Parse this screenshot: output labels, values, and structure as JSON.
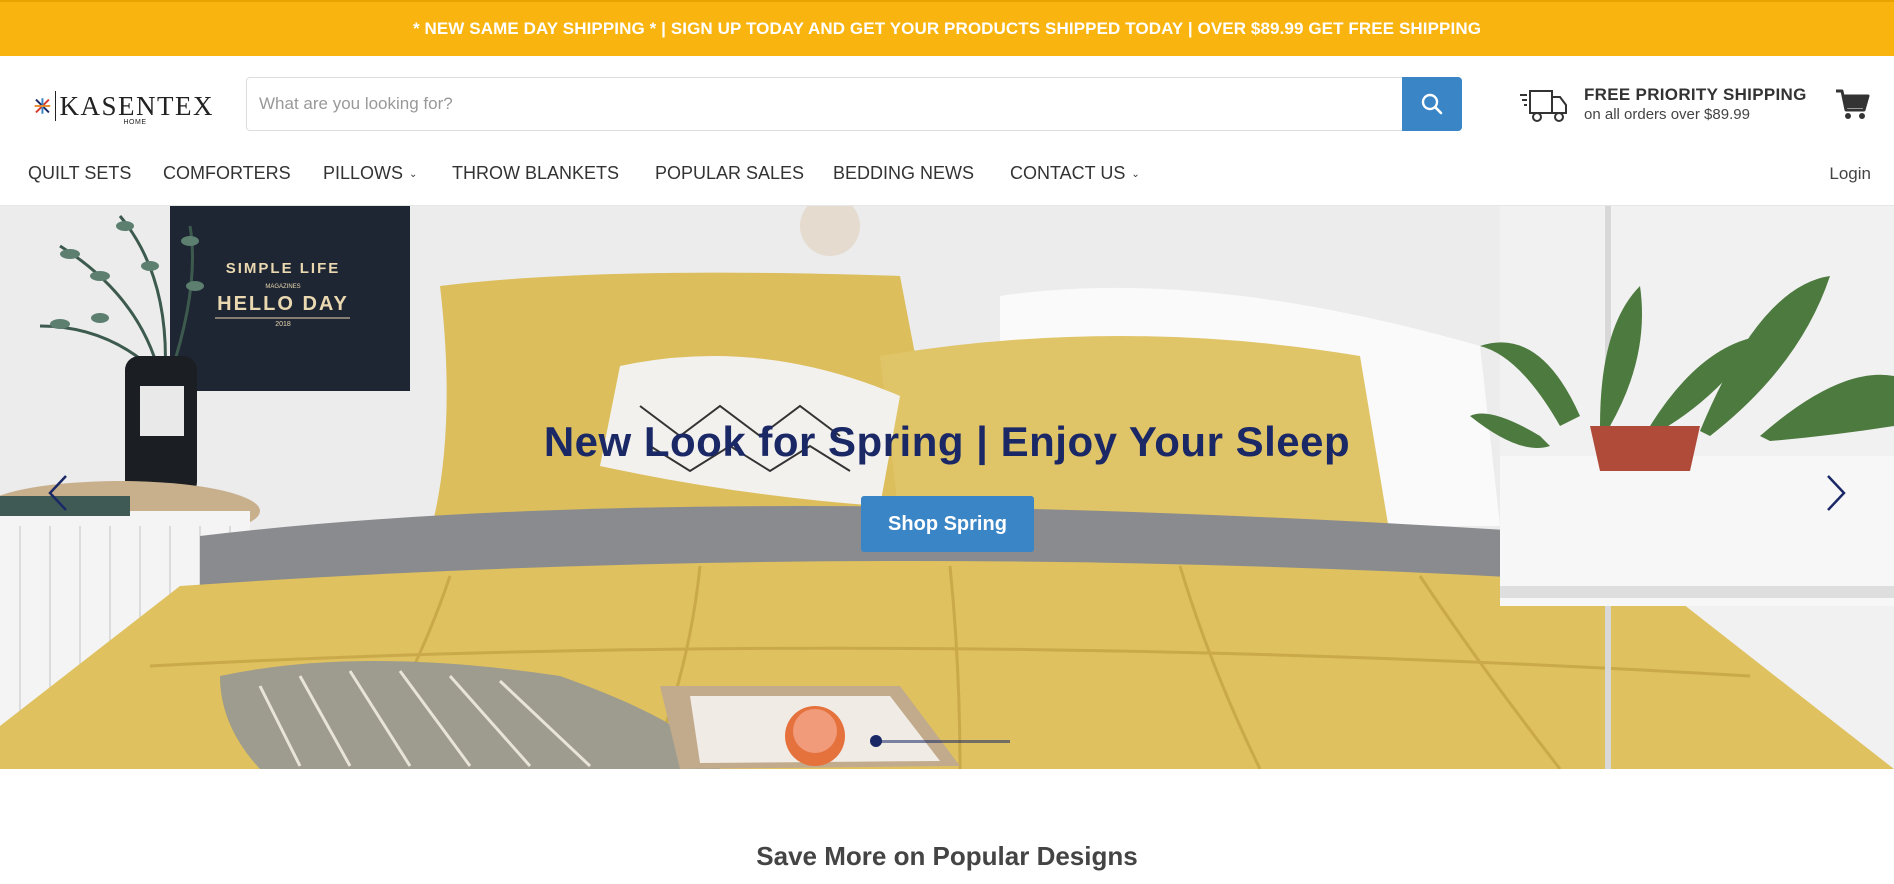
{
  "announcement": "* NEW SAME DAY SHIPPING * | SIGN UP TODAY AND GET YOUR PRODUCTS SHIPPED TODAY | OVER $89.99 GET FREE SHIPPING",
  "brand": {
    "name": "KASENTEX",
    "sub": "HOME"
  },
  "search": {
    "placeholder": "What are you looking for?",
    "value": ""
  },
  "shipping": {
    "title": "FREE PRIORITY SHIPPING",
    "subtitle": "on all orders over $89.99"
  },
  "nav": {
    "items": [
      {
        "label": "QUILT SETS",
        "dropdown": false
      },
      {
        "label": "COMFORTERS",
        "dropdown": false
      },
      {
        "label": "PILLOWS",
        "dropdown": true
      },
      {
        "label": "THROW BLANKETS",
        "dropdown": false
      },
      {
        "label": "POPULAR SALES",
        "dropdown": false
      },
      {
        "label": "BEDDING NEWS",
        "dropdown": false
      },
      {
        "label": "CONTACT US",
        "dropdown": true
      }
    ],
    "login": "Login"
  },
  "hero": {
    "title": "New Look for Spring | Enjoy Your Sleep",
    "button": "Shop Spring",
    "poster": {
      "line1": "SIMPLE LIFE",
      "line2": "MAGAZINES",
      "line3": "HELLO DAY",
      "line4": "2018"
    },
    "slide_count": 1,
    "active_slide": 1
  },
  "section": {
    "title": "Save More on Popular Designs"
  },
  "colors": {
    "announcement_bg": "#f9b410",
    "accent": "#3a85c6",
    "hero_title": "#1a2866"
  },
  "icons": [
    "search-icon",
    "truck-icon",
    "cart-icon",
    "chevron-down-icon",
    "arrow-left-icon",
    "arrow-right-icon"
  ]
}
